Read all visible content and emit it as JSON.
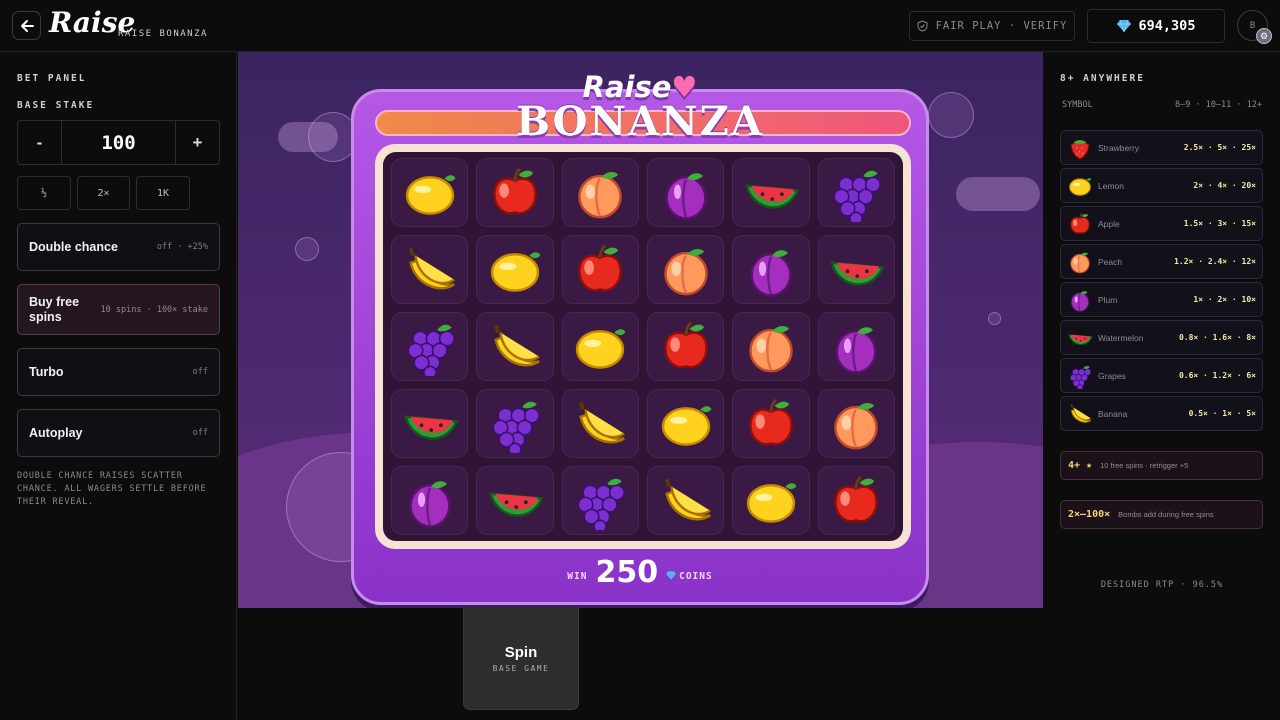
{
  "header": {
    "back_icon": "arrow-left-icon",
    "logo": "Raise",
    "game_name": "RAISE BONANZA",
    "fair_play": "FAIR PLAY · VERIFY",
    "balance": "694,305",
    "avatar_initial": "B"
  },
  "bet_panel": {
    "title": "BET PANEL",
    "stake_label": "BASE STAKE",
    "stake_value": "100",
    "minus": "-",
    "plus": "+",
    "quick": [
      "½",
      "2×",
      "1K"
    ],
    "options": [
      {
        "name": "Double chance",
        "sub": "off · +25%"
      },
      {
        "name": "Buy free spins",
        "sub": "10 spins · 100× stake"
      },
      {
        "name": "Turbo",
        "sub": "off"
      },
      {
        "name": "Autoplay",
        "sub": "off"
      }
    ],
    "note": "DOUBLE CHANCE RAISES SCATTER CHANCE. ALL WAGERS SETTLE BEFORE THEIR REVEAL."
  },
  "game": {
    "title_top": "Raise",
    "title_main": "BONANZA",
    "grid": [
      [
        "lemon",
        "apple",
        "peach",
        "plum",
        "watermelon",
        "grapes"
      ],
      [
        "banana",
        "lemon",
        "apple",
        "peach",
        "plum",
        "watermelon"
      ],
      [
        "grapes",
        "banana",
        "lemon",
        "apple",
        "peach",
        "plum"
      ],
      [
        "watermelon",
        "grapes",
        "banana",
        "lemon",
        "apple",
        "peach"
      ],
      [
        "plum",
        "watermelon",
        "grapes",
        "banana",
        "lemon",
        "apple"
      ]
    ],
    "win_label": "WIN",
    "win_value": "250",
    "coins_label": "COINS"
  },
  "spin": {
    "label": "Spin",
    "sub": "BASE GAME"
  },
  "paytable": {
    "title": "8+ ANYWHERE",
    "col_symbol": "SYMBOL",
    "col_counts": "8–9 · 10–11 · 12+",
    "rows": [
      {
        "symbol": "strawberry",
        "name": "Strawberry",
        "pays": "2.5× · 5× · 25×"
      },
      {
        "symbol": "lemon",
        "name": "Lemon",
        "pays": "2× · 4× · 20×"
      },
      {
        "symbol": "apple",
        "name": "Apple",
        "pays": "1.5× · 3× · 15×"
      },
      {
        "symbol": "peach",
        "name": "Peach",
        "pays": "1.2× · 2.4× · 12×"
      },
      {
        "symbol": "plum",
        "name": "Plum",
        "pays": "1× · 2× · 10×"
      },
      {
        "symbol": "watermelon",
        "name": "Watermelon",
        "pays": "0.8× · 1.6× · 8×"
      },
      {
        "symbol": "grapes",
        "name": "Grapes",
        "pays": "0.6× · 1.2× · 6×"
      },
      {
        "symbol": "banana",
        "name": "Banana",
        "pays": "0.5× · 1× · 5×"
      }
    ],
    "features": [
      {
        "key": "4+ ★",
        "desc": "10 free spins · retrigger +5"
      },
      {
        "key": "2×–100×",
        "desc": "Bombs add during free spins"
      }
    ],
    "rtp": "DESIGNED RTP · 96.5%"
  }
}
